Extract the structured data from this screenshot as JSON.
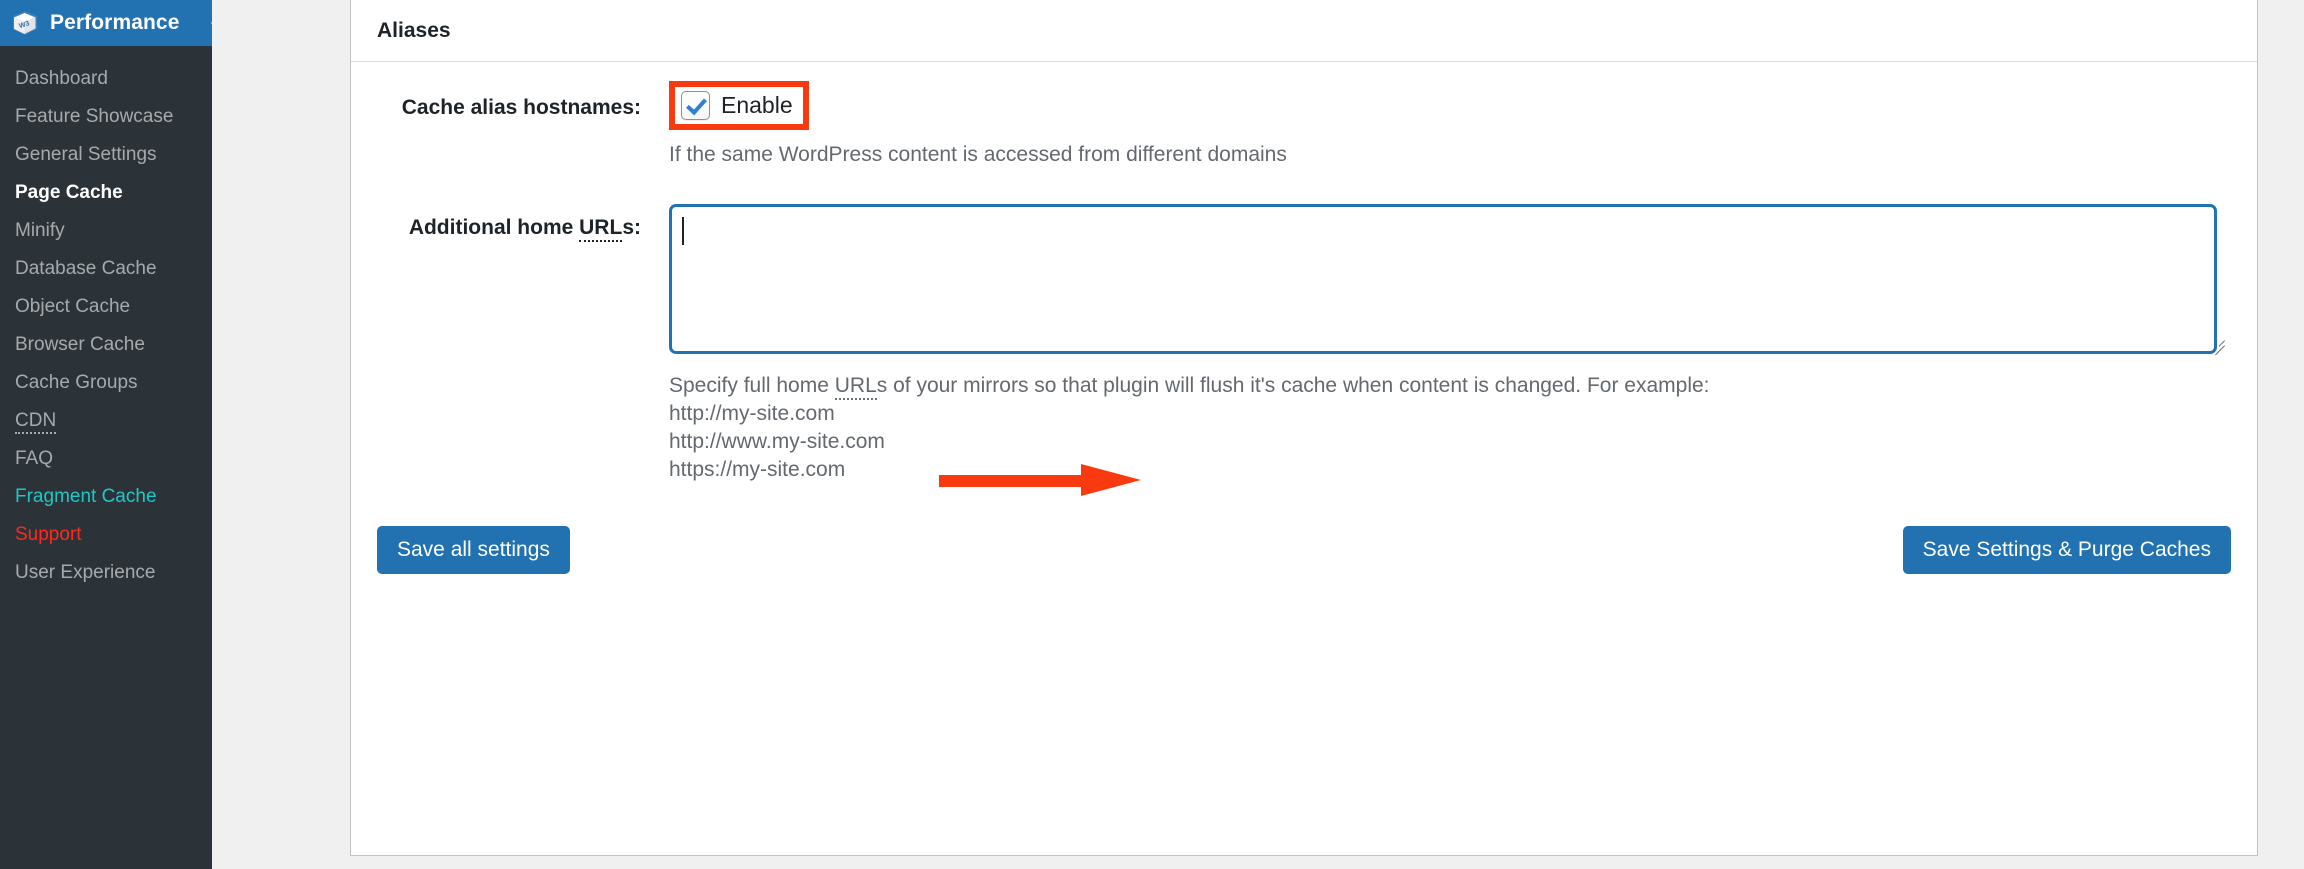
{
  "sidebar": {
    "brand": {
      "title": "Performance",
      "logo_icon": "w3-cube-logo-icon",
      "arrow_icon": "sidebar-pointer-arrow-icon",
      "background_color": "#2271b1"
    },
    "background_color": "#2c3338",
    "items": [
      {
        "label": "Dashboard",
        "state": "default"
      },
      {
        "label": "Feature Showcase",
        "state": "default"
      },
      {
        "label": "General Settings",
        "state": "default"
      },
      {
        "label": "Page Cache",
        "state": "current"
      },
      {
        "label": "Minify",
        "state": "default"
      },
      {
        "label": "Database Cache",
        "state": "default"
      },
      {
        "label": "Object Cache",
        "state": "default"
      },
      {
        "label": "Browser Cache",
        "state": "default"
      },
      {
        "label": "Cache Groups",
        "state": "default"
      },
      {
        "label": "CDN",
        "state": "abbr"
      },
      {
        "label": "FAQ",
        "state": "default"
      },
      {
        "label": "Fragment Cache",
        "state": "teal",
        "color": "#1ec8c8"
      },
      {
        "label": "Support",
        "state": "red",
        "color": "#ff2a1f"
      },
      {
        "label": "User Experience",
        "state": "default"
      }
    ]
  },
  "panel": {
    "header_title": "Aliases",
    "cache_alias": {
      "label": "Cache alias hostnames:",
      "checkbox_label": "Enable",
      "checked": true,
      "hint": "If the same WordPress content is accessed from different domains",
      "highlight_color": "#f93a10"
    },
    "additional_home_urls": {
      "label_prefix": "Additional home ",
      "label_abbr": "URL",
      "label_suffix": "s:",
      "value": "",
      "placeholder": "",
      "focus_border_color": "#2271b1",
      "resize_handle_icon": "resize-grip-icon"
    },
    "description": {
      "part1": "Specify full home ",
      "abbr": "URL",
      "part2": "s of your mirrors so that plugin will flush it's cache when content is changed. For example:",
      "examples": [
        "http://my-site.com",
        "http://www.my-site.com",
        "https://my-site.com"
      ]
    },
    "annotation": {
      "arrow_icon": "red-pointer-arrow-icon",
      "color": "#f93a10"
    },
    "buttons": {
      "save_all": "Save all settings",
      "save_purge": "Save Settings & Purge Caches",
      "color": "#2271b1"
    }
  }
}
